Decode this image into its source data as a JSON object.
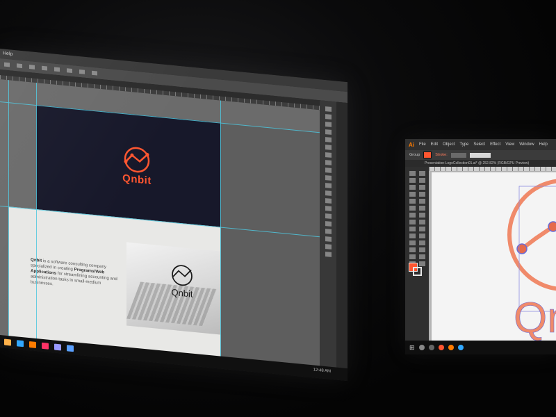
{
  "photoshop": {
    "menu": [
      "Help"
    ],
    "artboard_dark": {
      "logo_text": "Qnbit"
    },
    "artboard_light": {
      "logo_text": "Qnbit",
      "desc_brand": "Qnbit",
      "desc_part1": " is a software consulting company specialized in creating ",
      "desc_bold": "Programs/Web Applications",
      "desc_part2": " for streamlining accounting and administration tasks in small-medium businesses."
    },
    "taskbar": {
      "time": "12:48 AM"
    }
  },
  "illustrator": {
    "app_logo": "Ai",
    "menu": [
      "File",
      "Edit",
      "Object",
      "Type",
      "Select",
      "Effect",
      "View",
      "Window",
      "Help"
    ],
    "control": {
      "selection": "Group",
      "stroke_label": "Stroke:"
    },
    "doc_tab": "Presentation-LogoCollection01.ai* @ 252.82% (RGB/GPU Preview)",
    "taskbar": {
      "win_symbol": "⊞"
    }
  },
  "colors": {
    "brand_orange": "#ff5630",
    "guide_cyan": "#4fc7de",
    "dark_artboard": "#17182a"
  }
}
